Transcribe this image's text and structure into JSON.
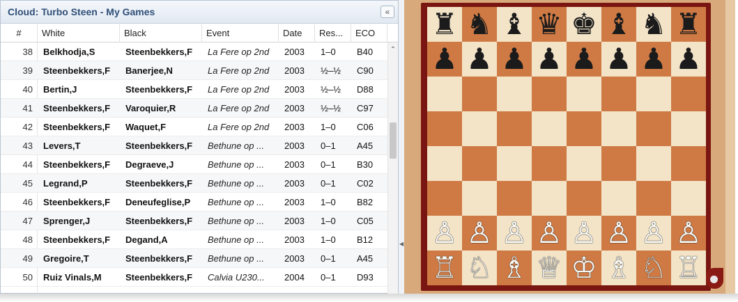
{
  "panel": {
    "title": "Cloud: Turbo Steen - My Games",
    "collapse_icon": "«"
  },
  "columns": [
    "#",
    "White",
    "Black",
    "Event",
    "Date",
    "Res...",
    "ECO"
  ],
  "games": [
    {
      "num": "38",
      "white": "Belkhodja,S",
      "black": "Steenbekkers,F",
      "event": "La Fere op 2nd",
      "date": "2003",
      "result": "1–0",
      "eco": "B40"
    },
    {
      "num": "39",
      "white": "Steenbekkers,F",
      "black": "Banerjee,N",
      "event": "La Fere op 2nd",
      "date": "2003",
      "result": "½–½",
      "eco": "C90"
    },
    {
      "num": "40",
      "white": "Bertin,J",
      "black": "Steenbekkers,F",
      "event": "La Fere op 2nd",
      "date": "2003",
      "result": "½–½",
      "eco": "D88"
    },
    {
      "num": "41",
      "white": "Steenbekkers,F",
      "black": "Varoquier,R",
      "event": "La Fere op 2nd",
      "date": "2003",
      "result": "½–½",
      "eco": "C97"
    },
    {
      "num": "42",
      "white": "Steenbekkers,F",
      "black": "Waquet,F",
      "event": "La Fere op 2nd",
      "date": "2003",
      "result": "1–0",
      "eco": "C06"
    },
    {
      "num": "43",
      "white": "Levers,T",
      "black": "Steenbekkers,F",
      "event": "Bethune op ...",
      "date": "2003",
      "result": "0–1",
      "eco": "A45"
    },
    {
      "num": "44",
      "white": "Steenbekkers,F",
      "black": "Degraeve,J",
      "event": "Bethune op ...",
      "date": "2003",
      "result": "0–1",
      "eco": "B30"
    },
    {
      "num": "45",
      "white": "Legrand,P",
      "black": "Steenbekkers,F",
      "event": "Bethune op ...",
      "date": "2003",
      "result": "0–1",
      "eco": "C02"
    },
    {
      "num": "46",
      "white": "Steenbekkers,F",
      "black": "Deneufeglise,P",
      "event": "Bethune op ...",
      "date": "2003",
      "result": "1–0",
      "eco": "B82"
    },
    {
      "num": "47",
      "white": "Sprenger,J",
      "black": "Steenbekkers,F",
      "event": "Bethune op ...",
      "date": "2003",
      "result": "1–0",
      "eco": "C05"
    },
    {
      "num": "48",
      "white": "Steenbekkers,F",
      "black": "Degand,A",
      "event": "Bethune op ...",
      "date": "2003",
      "result": "1–0",
      "eco": "B12"
    },
    {
      "num": "49",
      "white": "Gregoire,T",
      "black": "Steenbekkers,F",
      "event": "Bethune op ...",
      "date": "2003",
      "result": "0–1",
      "eco": "A45"
    },
    {
      "num": "50",
      "white": "Ruiz Vinals,M",
      "black": "Steenbekkers,F",
      "event": "Calvia U230...",
      "date": "2004",
      "result": "0–1",
      "eco": "D93"
    }
  ],
  "board": {
    "ranks": [
      [
        "♜",
        "♞",
        "♝",
        "♛",
        "♚",
        "♝",
        "♞",
        "♜"
      ],
      [
        "♟",
        "♟",
        "♟",
        "♟",
        "♟",
        "♟",
        "♟",
        "♟"
      ],
      [
        "",
        "",
        "",
        "",
        "",
        "",
        "",
        ""
      ],
      [
        "",
        "",
        "",
        "",
        "",
        "",
        "",
        ""
      ],
      [
        "",
        "",
        "",
        "",
        "",
        "",
        "",
        ""
      ],
      [
        "",
        "",
        "",
        "",
        "",
        "",
        "",
        ""
      ],
      [
        "♙",
        "♙",
        "♙",
        "♙",
        "♙",
        "♙",
        "♙",
        "♙"
      ],
      [
        "♖",
        "♘",
        "♗",
        "♕",
        "♔",
        "♗",
        "♘",
        "♖"
      ]
    ],
    "light_color": "#f3e4c8",
    "dark_color": "#cf7a44",
    "frame_color": "#7a1612"
  }
}
